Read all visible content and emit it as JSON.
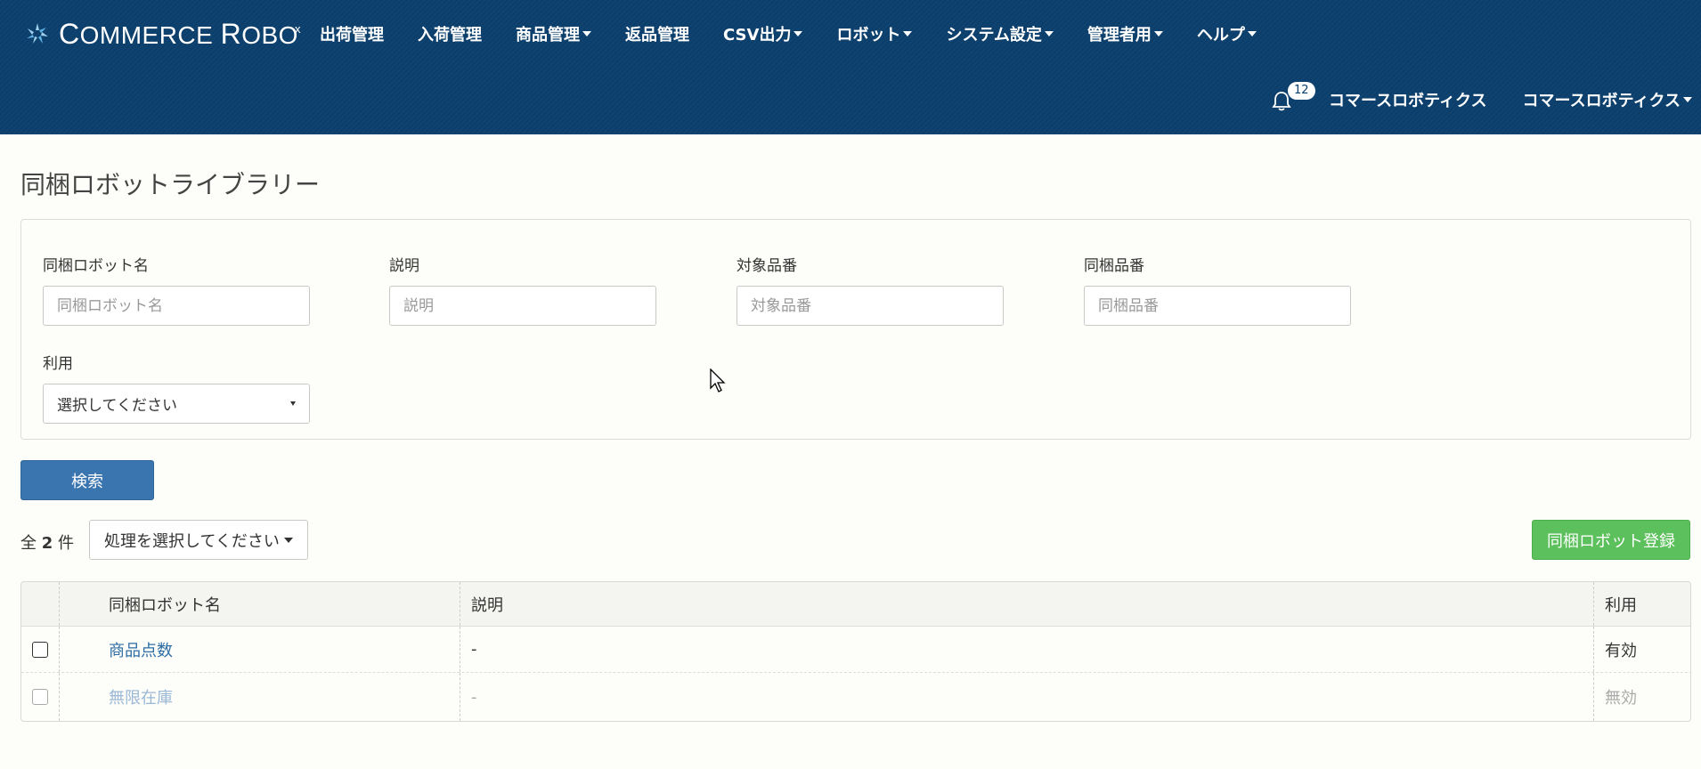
{
  "brand": {
    "logo_text_main": "C",
    "logo_text_rest": "OMMERCE ",
    "logo_text_r": "R",
    "logo_text_obo": "OBO",
    "logo_sup": "x"
  },
  "nav": {
    "items": [
      {
        "label": "出荷管理",
        "has_caret": false
      },
      {
        "label": "入荷管理",
        "has_caret": false
      },
      {
        "label": "商品管理",
        "has_caret": true
      },
      {
        "label": "返品管理",
        "has_caret": false
      },
      {
        "label": "CSV出力",
        "has_caret": true
      },
      {
        "label": "ロボット",
        "has_caret": true
      },
      {
        "label": "システム設定",
        "has_caret": true
      },
      {
        "label": "管理者用",
        "has_caret": true
      },
      {
        "label": "ヘルプ",
        "has_caret": true
      }
    ]
  },
  "user_bar": {
    "notification_count": "12",
    "company_link": "コマースロボティクス",
    "user_menu": "コマースロボティクス"
  },
  "page": {
    "title": "同梱ロボットライブラリー"
  },
  "filters": {
    "robot_name": {
      "label": "同梱ロボット名",
      "placeholder": "同梱ロボット名"
    },
    "description": {
      "label": "説明",
      "placeholder": "説明"
    },
    "target_sku": {
      "label": "対象品番",
      "placeholder": "対象品番"
    },
    "bundle_sku": {
      "label": "同梱品番",
      "placeholder": "同梱品番"
    },
    "usage": {
      "label": "利用",
      "selected": "選択してください"
    }
  },
  "actions": {
    "search_label": "検索",
    "count_prefix": "全",
    "count_value": "2",
    "count_suffix": "件",
    "bulk_action": "処理を選択してください",
    "register_label": "同梱ロボット登録"
  },
  "table": {
    "headers": {
      "name": "同梱ロボット名",
      "description": "説明",
      "usage": "利用"
    },
    "rows": [
      {
        "name": "商品点数",
        "description": "-",
        "usage": "有効"
      },
      {
        "name": "無限在庫",
        "description": "-",
        "usage": "無効"
      }
    ]
  },
  "colors": {
    "header_bg": "#0b3f6c",
    "primary": "#3a75b0",
    "success": "#5cc05c",
    "link": "#2e6da4"
  }
}
